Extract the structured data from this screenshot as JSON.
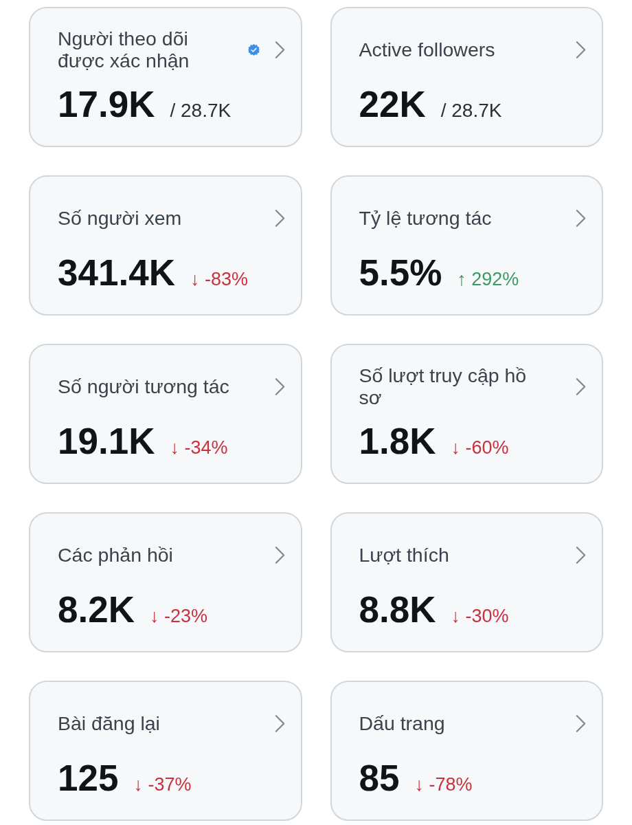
{
  "cards": [
    {
      "kind": "ratio",
      "title": "Người theo dõi được xác nhận",
      "verified": true,
      "value": "17.9K",
      "total": "/ 28.7K"
    },
    {
      "kind": "ratio",
      "title": "Active followers",
      "verified": false,
      "value": "22K",
      "total": "/ 28.7K"
    },
    {
      "kind": "change",
      "title": "Số người xem",
      "verified": false,
      "value": "341.4K",
      "positive": false,
      "change": "↓ -83%"
    },
    {
      "kind": "change",
      "title": "Tỷ lệ tương tác",
      "verified": false,
      "value": "5.5%",
      "positive": true,
      "change": "↑ 292%"
    },
    {
      "kind": "change",
      "title": "Số người tương tác",
      "verified": false,
      "value": "19.1K",
      "positive": false,
      "change": "↓ -34%"
    },
    {
      "kind": "change",
      "title": "Số lượt truy cập hồ sơ",
      "verified": false,
      "value": "1.8K",
      "positive": false,
      "change": "↓ -60%"
    },
    {
      "kind": "change",
      "title": "Các phản hồi",
      "verified": false,
      "value": "8.2K",
      "positive": false,
      "change": "↓ -23%"
    },
    {
      "kind": "change",
      "title": "Lượt thích",
      "verified": false,
      "value": "8.8K",
      "positive": false,
      "change": "↓ -30%"
    },
    {
      "kind": "change",
      "title": "Bài đăng lại",
      "verified": false,
      "value": "125",
      "positive": false,
      "change": "↓ -37%"
    },
    {
      "kind": "change",
      "title": "Dấu trang",
      "verified": false,
      "value": "85",
      "positive": false,
      "change": "↓ -78%"
    }
  ]
}
